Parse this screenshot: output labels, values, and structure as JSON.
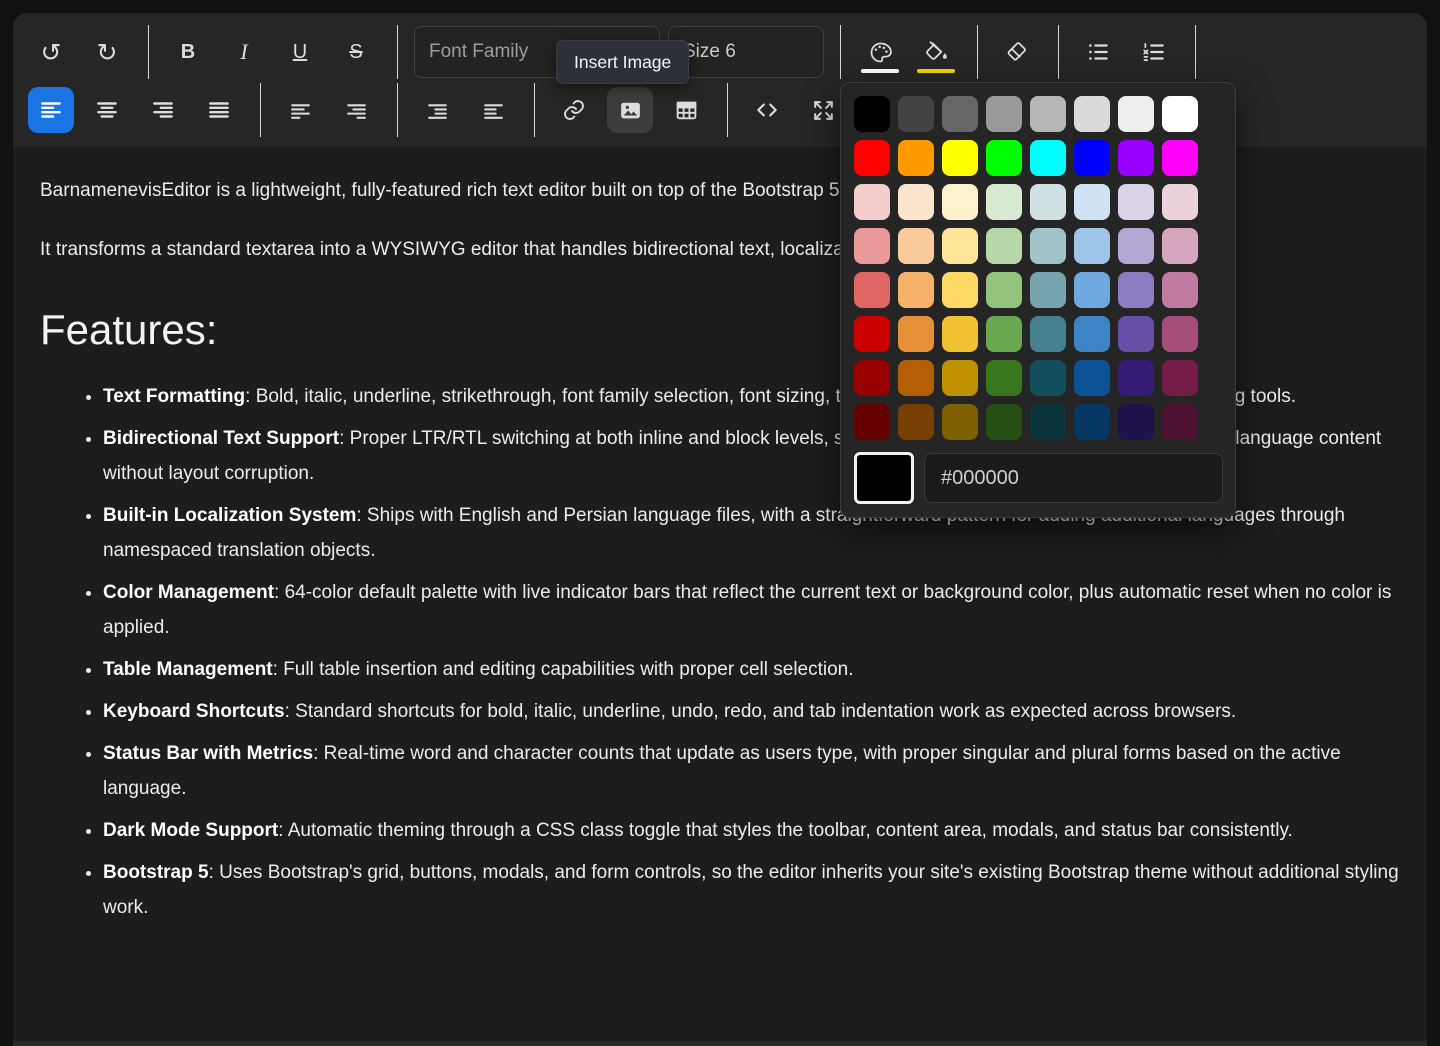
{
  "colors": {
    "accent": "#1b74e4",
    "text_indicator": "#ffffff",
    "bg_indicator": "#f2d500"
  },
  "icons": {
    "undo": "↺",
    "redo": "↻"
  },
  "toolbar": {
    "bold_label": "B",
    "italic_label": "I",
    "underline_label": "U",
    "strikethrough_label": "S",
    "font_family_placeholder": "Font Family",
    "font_size_value": "Size 6"
  },
  "tooltip": {
    "text": "Insert Image"
  },
  "color_picker": {
    "hex_value": "#000000",
    "selected_hex": "#000000",
    "palette": [
      "#000000",
      "#434343",
      "#666666",
      "#999999",
      "#b7b7b7",
      "#d9d9d9",
      "#efefef",
      "#ffffff",
      "#ff0000",
      "#ff9900",
      "#ffff00",
      "#00ff00",
      "#00ffff",
      "#0000ff",
      "#9900ff",
      "#ff00ff",
      "#f4cccc",
      "#fce5cd",
      "#fff2cc",
      "#d9ead3",
      "#d0e0e3",
      "#cfe2f3",
      "#d9d2e9",
      "#ead1dc",
      "#ea9999",
      "#f9cb9c",
      "#ffe599",
      "#b6d7a8",
      "#a2c4c9",
      "#9fc5e8",
      "#b4a7d6",
      "#d5a6bd",
      "#e06666",
      "#f6b26b",
      "#ffd966",
      "#93c47d",
      "#76a5af",
      "#6fa8dc",
      "#8e7cc3",
      "#c27ba0",
      "#cc0000",
      "#e69138",
      "#f1c232",
      "#6aa84f",
      "#45818e",
      "#3d85c6",
      "#674ea7",
      "#a64d79",
      "#990000",
      "#b45f06",
      "#bf9000",
      "#38761d",
      "#134f5c",
      "#0b5394",
      "#351c75",
      "#741b47",
      "#660000",
      "#783f04",
      "#7f6000",
      "#274e13",
      "#0c343d",
      "#073763",
      "#20124d",
      "#4c1130"
    ]
  },
  "content": {
    "intro": [
      "BarnamenevisEditor is a lightweight, fully-featured rich text editor built on top of the Bootstrap 5 framework.",
      "It transforms a standard textarea into a WYSIWYG editor that handles bidirectional text, localization, and dark mode interfaces out of the box."
    ],
    "heading": "Features:",
    "features": [
      {
        "lead": "Text Formatting",
        "text": ": Bold, italic, underline, strikethrough, font family selection, font sizing, text color, background color, and clear formatting tools."
      },
      {
        "lead": "Bidirectional Text Support",
        "text": ": Proper LTR/RTL switching at both inline and block levels, supporting Arabic, Persian, Hebrew, and mixed-language content without layout corruption."
      },
      {
        "lead": "Built-in Localization System",
        "text": ": Ships with English and Persian language files, with a straightforward pattern for adding additional languages through namespaced translation objects."
      },
      {
        "lead": "Color Management",
        "text": ": 64-color default palette with live indicator bars that reflect the current text or background color, plus automatic reset when no color is applied."
      },
      {
        "lead": "Table Management",
        "text": ": Full table insertion and editing capabilities with proper cell selection."
      },
      {
        "lead": "Keyboard Shortcuts",
        "text": ": Standard shortcuts for bold, italic, underline, undo, redo, and tab indentation work as expected across browsers."
      },
      {
        "lead": "Status Bar with Metrics",
        "text": ": Real-time word and character counts that update as users type, with proper singular and plural forms based on the active language."
      },
      {
        "lead": "Dark Mode Support",
        "text": ": Automatic theming through a CSS class toggle that styles the toolbar, content area, modals, and status bar consistently."
      },
      {
        "lead": "Bootstrap 5",
        "text": ": Uses Bootstrap's grid, buttons, modals, and form controls, so the editor inherits your site's existing Bootstrap theme without additional styling work."
      }
    ]
  }
}
